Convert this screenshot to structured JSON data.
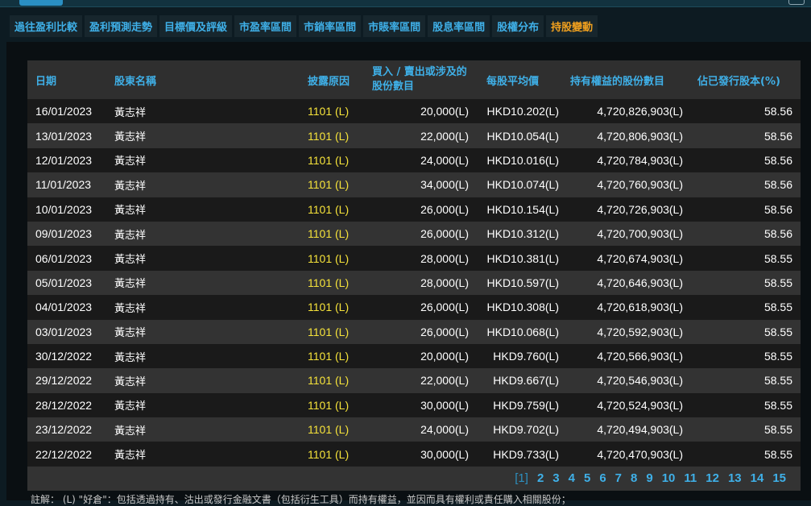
{
  "nav": {
    "tabs": [
      {
        "label": "過往盈利比較",
        "active": false
      },
      {
        "label": "盈利預測走勢",
        "active": false
      },
      {
        "label": "目標價及評級",
        "active": false
      },
      {
        "label": "市盈率區間",
        "active": false
      },
      {
        "label": "市銷率區間",
        "active": false
      },
      {
        "label": "市賬率區間",
        "active": false
      },
      {
        "label": "股息率區間",
        "active": false
      },
      {
        "label": "股權分布",
        "active": false
      },
      {
        "label": "持股變動",
        "active": true
      }
    ]
  },
  "table": {
    "headers": {
      "date": "日期",
      "name": "股東名稱",
      "reason": "披露原因",
      "qty": "買入 / 賣出或涉及的股份數目",
      "avg": "每股平均價",
      "held": "持有權益的股份數目",
      "pct": "佔已發行股本(%)"
    },
    "rows": [
      {
        "date": "16/01/2023",
        "name": "黃志祥",
        "reason": "1101 (L)",
        "qty": "20,000(L)",
        "avg": "HKD10.202(L)",
        "held": "4,720,826,903(L)",
        "pct": "58.56"
      },
      {
        "date": "13/01/2023",
        "name": "黃志祥",
        "reason": "1101 (L)",
        "qty": "22,000(L)",
        "avg": "HKD10.054(L)",
        "held": "4,720,806,903(L)",
        "pct": "58.56"
      },
      {
        "date": "12/01/2023",
        "name": "黃志祥",
        "reason": "1101 (L)",
        "qty": "24,000(L)",
        "avg": "HKD10.016(L)",
        "held": "4,720,784,903(L)",
        "pct": "58.56"
      },
      {
        "date": "11/01/2023",
        "name": "黃志祥",
        "reason": "1101 (L)",
        "qty": "34,000(L)",
        "avg": "HKD10.074(L)",
        "held": "4,720,760,903(L)",
        "pct": "58.56"
      },
      {
        "date": "10/01/2023",
        "name": "黃志祥",
        "reason": "1101 (L)",
        "qty": "26,000(L)",
        "avg": "HKD10.154(L)",
        "held": "4,720,726,903(L)",
        "pct": "58.56"
      },
      {
        "date": "09/01/2023",
        "name": "黃志祥",
        "reason": "1101 (L)",
        "qty": "26,000(L)",
        "avg": "HKD10.312(L)",
        "held": "4,720,700,903(L)",
        "pct": "58.56"
      },
      {
        "date": "06/01/2023",
        "name": "黃志祥",
        "reason": "1101 (L)",
        "qty": "28,000(L)",
        "avg": "HKD10.381(L)",
        "held": "4,720,674,903(L)",
        "pct": "58.55"
      },
      {
        "date": "05/01/2023",
        "name": "黃志祥",
        "reason": "1101 (L)",
        "qty": "28,000(L)",
        "avg": "HKD10.597(L)",
        "held": "4,720,646,903(L)",
        "pct": "58.55"
      },
      {
        "date": "04/01/2023",
        "name": "黃志祥",
        "reason": "1101 (L)",
        "qty": "26,000(L)",
        "avg": "HKD10.308(L)",
        "held": "4,720,618,903(L)",
        "pct": "58.55"
      },
      {
        "date": "03/01/2023",
        "name": "黃志祥",
        "reason": "1101 (L)",
        "qty": "26,000(L)",
        "avg": "HKD10.068(L)",
        "held": "4,720,592,903(L)",
        "pct": "58.55"
      },
      {
        "date": "30/12/2022",
        "name": "黃志祥",
        "reason": "1101 (L)",
        "qty": "20,000(L)",
        "avg": "HKD9.760(L)",
        "held": "4,720,566,903(L)",
        "pct": "58.55"
      },
      {
        "date": "29/12/2022",
        "name": "黃志祥",
        "reason": "1101 (L)",
        "qty": "22,000(L)",
        "avg": "HKD9.667(L)",
        "held": "4,720,546,903(L)",
        "pct": "58.55"
      },
      {
        "date": "28/12/2022",
        "name": "黃志祥",
        "reason": "1101 (L)",
        "qty": "30,000(L)",
        "avg": "HKD9.759(L)",
        "held": "4,720,524,903(L)",
        "pct": "58.55"
      },
      {
        "date": "23/12/2022",
        "name": "黃志祥",
        "reason": "1101 (L)",
        "qty": "24,000(L)",
        "avg": "HKD9.702(L)",
        "held": "4,720,494,903(L)",
        "pct": "58.55"
      },
      {
        "date": "22/12/2022",
        "name": "黃志祥",
        "reason": "1101 (L)",
        "qty": "30,000(L)",
        "avg": "HKD9.733(L)",
        "held": "4,720,470,903(L)",
        "pct": "58.55"
      }
    ]
  },
  "pagination": {
    "pages": [
      "[1]",
      "2",
      "3",
      "4",
      "5",
      "6",
      "7",
      "8",
      "9",
      "10",
      "11",
      "12",
      "13",
      "14",
      "15"
    ],
    "current_index": 0
  },
  "footnote": "註解： (L) \"好倉\"：包括透過持有、沽出或發行金融文書（包括衍生工具）而持有權益，並因而具有權利或責任購入相關股份；"
}
